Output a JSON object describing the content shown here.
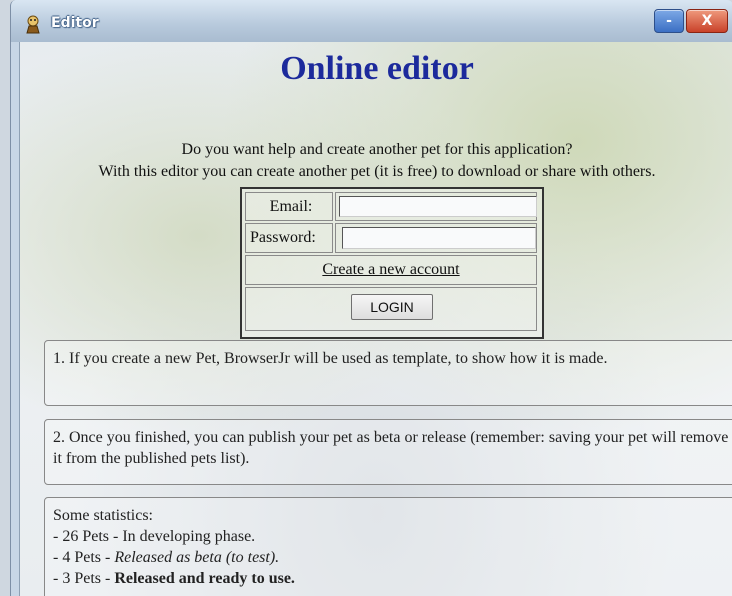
{
  "window": {
    "title": "Editor",
    "minimize_label": "-",
    "close_label": "X"
  },
  "page": {
    "title": "Online editor",
    "intro_line1": "Do you want help and create another pet for this application?",
    "intro_line2": "With this editor you can create another pet (it is free) to download or share with others."
  },
  "login": {
    "email_label": "Email:",
    "email_value": "",
    "password_label": "Password:",
    "password_value": "",
    "create_account_link": "Create a new account",
    "login_button": "LOGIN"
  },
  "info": {
    "panel1": "1. If you create a new Pet, BrowserJr will be used as template, to show how it is made.",
    "panel2": "2. Once you finished, you can publish your pet as beta or release (remember: saving your pet will remove it from the published pets list).",
    "stats_title": "Some statistics:",
    "stats": [
      {
        "prefix": "- 26 Pets - ",
        "text": "In developing phase."
      },
      {
        "prefix": "- 4 Pets - ",
        "text": "Released as beta (to test)."
      },
      {
        "prefix": "- 3 Pets - ",
        "text": "Released and ready to use."
      }
    ]
  },
  "icons": {
    "app_icon": "pet-character-icon"
  }
}
